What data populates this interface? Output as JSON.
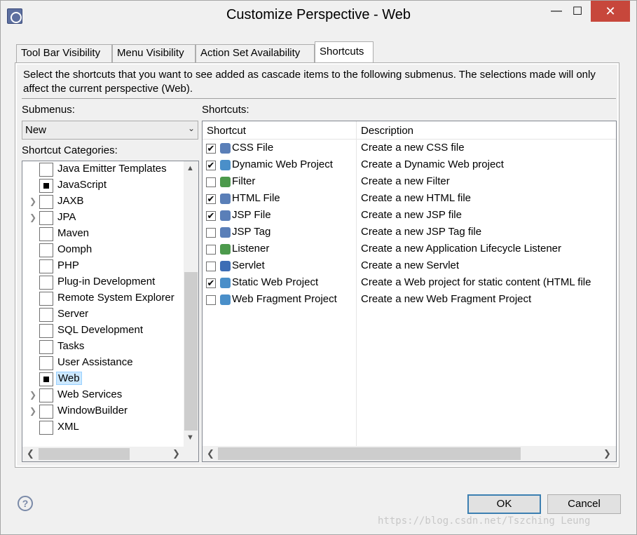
{
  "window": {
    "title": "Customize Perspective - Web",
    "minimize": "—",
    "maximize": "☐",
    "close": "✕"
  },
  "tabs": [
    {
      "label": "Tool Bar Visibility"
    },
    {
      "label": "Menu Visibility"
    },
    {
      "label": "Action Set Availability"
    },
    {
      "label": "Shortcuts",
      "active": true
    }
  ],
  "description": "Select the shortcuts that you want to see added as cascade items to the following submenus.  The selections made will only affect the current perspective (Web).",
  "submenus": {
    "label": "Submenus:",
    "selected": "New"
  },
  "shortcut_categories": {
    "label": "Shortcut Categories:",
    "items": [
      {
        "label": "Java Emitter Templates",
        "state": "unchecked",
        "expandable": false
      },
      {
        "label": "JavaScript",
        "state": "partial",
        "expandable": false
      },
      {
        "label": "JAXB",
        "state": "unchecked",
        "expandable": true
      },
      {
        "label": "JPA",
        "state": "unchecked",
        "expandable": true
      },
      {
        "label": "Maven",
        "state": "unchecked",
        "expandable": false
      },
      {
        "label": "Oomph",
        "state": "unchecked",
        "expandable": false
      },
      {
        "label": "PHP",
        "state": "unchecked",
        "expandable": false
      },
      {
        "label": "Plug-in Development",
        "state": "unchecked",
        "expandable": false
      },
      {
        "label": "Remote System Explorer",
        "state": "unchecked",
        "expandable": false
      },
      {
        "label": "Server",
        "state": "unchecked",
        "expandable": false
      },
      {
        "label": "SQL Development",
        "state": "unchecked",
        "expandable": false
      },
      {
        "label": "Tasks",
        "state": "unchecked",
        "expandable": false
      },
      {
        "label": "User Assistance",
        "state": "unchecked",
        "expandable": false
      },
      {
        "label": "Web",
        "state": "partial",
        "expandable": false,
        "selected": true
      },
      {
        "label": "Web Services",
        "state": "unchecked",
        "expandable": true
      },
      {
        "label": "WindowBuilder",
        "state": "unchecked",
        "expandable": true
      },
      {
        "label": "XML",
        "state": "unchecked",
        "expandable": false
      }
    ]
  },
  "shortcuts": {
    "label": "Shortcuts:",
    "columns": [
      "Shortcut",
      "Description"
    ],
    "rows": [
      {
        "name": "CSS File",
        "description": "Create a new CSS file",
        "checked": true,
        "icon": "css-file-icon",
        "color": "#5a7fb8"
      },
      {
        "name": "Dynamic Web Project",
        "description": "Create a Dynamic Web project",
        "checked": true,
        "icon": "web-project-icon",
        "color": "#4a8fc9"
      },
      {
        "name": "Filter",
        "description": "Create a new Filter",
        "checked": false,
        "icon": "filter-icon",
        "color": "#4c9a4c"
      },
      {
        "name": "HTML File",
        "description": "Create a new HTML file",
        "checked": true,
        "icon": "html-file-icon",
        "color": "#5a7fb8"
      },
      {
        "name": "JSP File",
        "description": "Create a new JSP file",
        "checked": true,
        "icon": "jsp-file-icon",
        "color": "#5a7fb8"
      },
      {
        "name": "JSP Tag",
        "description": "Create a new JSP Tag file",
        "checked": false,
        "icon": "jsp-tag-icon",
        "color": "#5a7fb8"
      },
      {
        "name": "Listener",
        "description": "Create a new Application Lifecycle Listener",
        "checked": false,
        "icon": "listener-icon",
        "color": "#4c9a4c"
      },
      {
        "name": "Servlet",
        "description": "Create a new Servlet",
        "checked": false,
        "icon": "servlet-icon",
        "color": "#3d6db5"
      },
      {
        "name": "Static Web Project",
        "description": "Create a Web project for static content (HTML file",
        "checked": true,
        "icon": "static-project-icon",
        "color": "#4a8fc9"
      },
      {
        "name": "Web Fragment Project",
        "description": "Create a new Web Fragment Project",
        "checked": false,
        "icon": "fragment-project-icon",
        "color": "#4a8fc9"
      }
    ]
  },
  "buttons": {
    "help": "?",
    "ok": "OK",
    "cancel": "Cancel"
  },
  "watermark": "https://blog.csdn.net/Tszching Leung"
}
